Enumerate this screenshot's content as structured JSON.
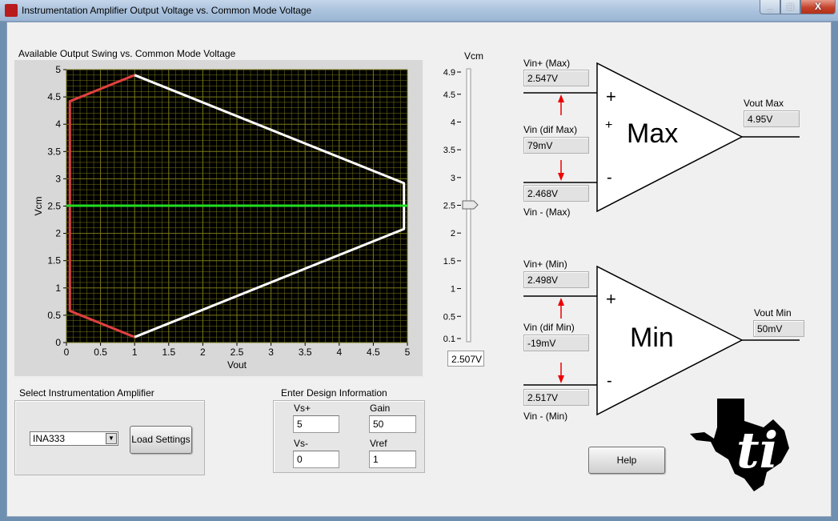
{
  "window": {
    "title": "Instrumentation Amplifier Output Voltage vs. Common Mode Voltage",
    "minimize_icon": "minimize-icon",
    "maximize_icon": "maximize-icon",
    "close_icon": "close-icon",
    "close_label": "X"
  },
  "chart_data": {
    "type": "line",
    "title": "Available Output Swing vs. Common Mode Voltage",
    "xlabel": "Vout",
    "ylabel": "Vcm",
    "xlim": [
      0,
      5
    ],
    "ylim": [
      0,
      5
    ],
    "x_ticks": [
      "0",
      "0.5",
      "1",
      "1.5",
      "2",
      "2.5",
      "3",
      "3.5",
      "4",
      "4.5",
      "5"
    ],
    "y_ticks": [
      "0",
      "0.5",
      "1",
      "1.5",
      "2",
      "2.5",
      "3",
      "3.5",
      "4",
      "4.5",
      "5"
    ],
    "grid": true,
    "background": "#000000",
    "grid_color": "#7a7a18",
    "series": [
      {
        "color": "#e04040",
        "points": [
          [
            1.0,
            0.1
          ],
          [
            0.05,
            0.58
          ],
          [
            0.05,
            4.42
          ],
          [
            1.0,
            4.9
          ]
        ]
      },
      {
        "color": "#ffffff",
        "points": [
          [
            1.0,
            4.9
          ],
          [
            4.95,
            2.92
          ],
          [
            4.95,
            2.08
          ],
          [
            1.0,
            0.1
          ]
        ]
      },
      {
        "color": "#22dd22",
        "points": [
          [
            0,
            2.507
          ],
          [
            5,
            2.507
          ]
        ]
      }
    ]
  },
  "slider": {
    "label": "Vcm",
    "ticks": [
      "4.9",
      "4.5",
      "4",
      "3.5",
      "3",
      "2.5",
      "2",
      "1.5",
      "1",
      "0.5",
      "0.1"
    ],
    "tick_values": [
      4.9,
      4.5,
      4,
      3.5,
      3,
      2.5,
      2,
      1.5,
      1,
      0.5,
      0.1
    ],
    "min": 0.1,
    "max": 4.9,
    "value": 2.507,
    "readout": "2.507V"
  },
  "amp_select": {
    "section_label": "Select Instrumentation Amplifier",
    "selected": "INA333",
    "dropdown_icon": "chevron-down-icon",
    "dropdown_glyph": "▼",
    "load_button": "Load Settings"
  },
  "design_info": {
    "section_label": "Enter Design Information",
    "vs_plus_label": "Vs+",
    "vs_plus": "5",
    "gain_label": "Gain",
    "gain": "50",
    "vs_minus_label": "Vs-",
    "vs_minus": "0",
    "vref_label": "Vref",
    "vref": "1"
  },
  "max_amp": {
    "symbol": "Max",
    "vin_plus_label": "Vin+ (Max)",
    "vin_plus": "2.547V",
    "vin_dif_label": "Vin (dif Max)",
    "vin_dif": "79mV",
    "vin_minus_label": "Vin - (Max)",
    "vin_minus": "2.468V",
    "vout_label": "Vout Max",
    "vout": "4.95V",
    "plus_sign": "+",
    "minus_sign": "-"
  },
  "min_amp": {
    "symbol": "Min",
    "vin_plus_label": "Vin+ (Min)",
    "vin_plus": "2.498V",
    "vin_dif_label": "Vin (dif Min)",
    "vin_dif": "-19mV",
    "vin_minus_label": "Vin - (Min)",
    "vin_minus": "2.517V",
    "vout_label": "Vout Min",
    "vout": "50mV",
    "plus_sign": "+",
    "minus_sign": "-"
  },
  "help_button": "Help",
  "logo_icon": "texas-instruments-logo"
}
